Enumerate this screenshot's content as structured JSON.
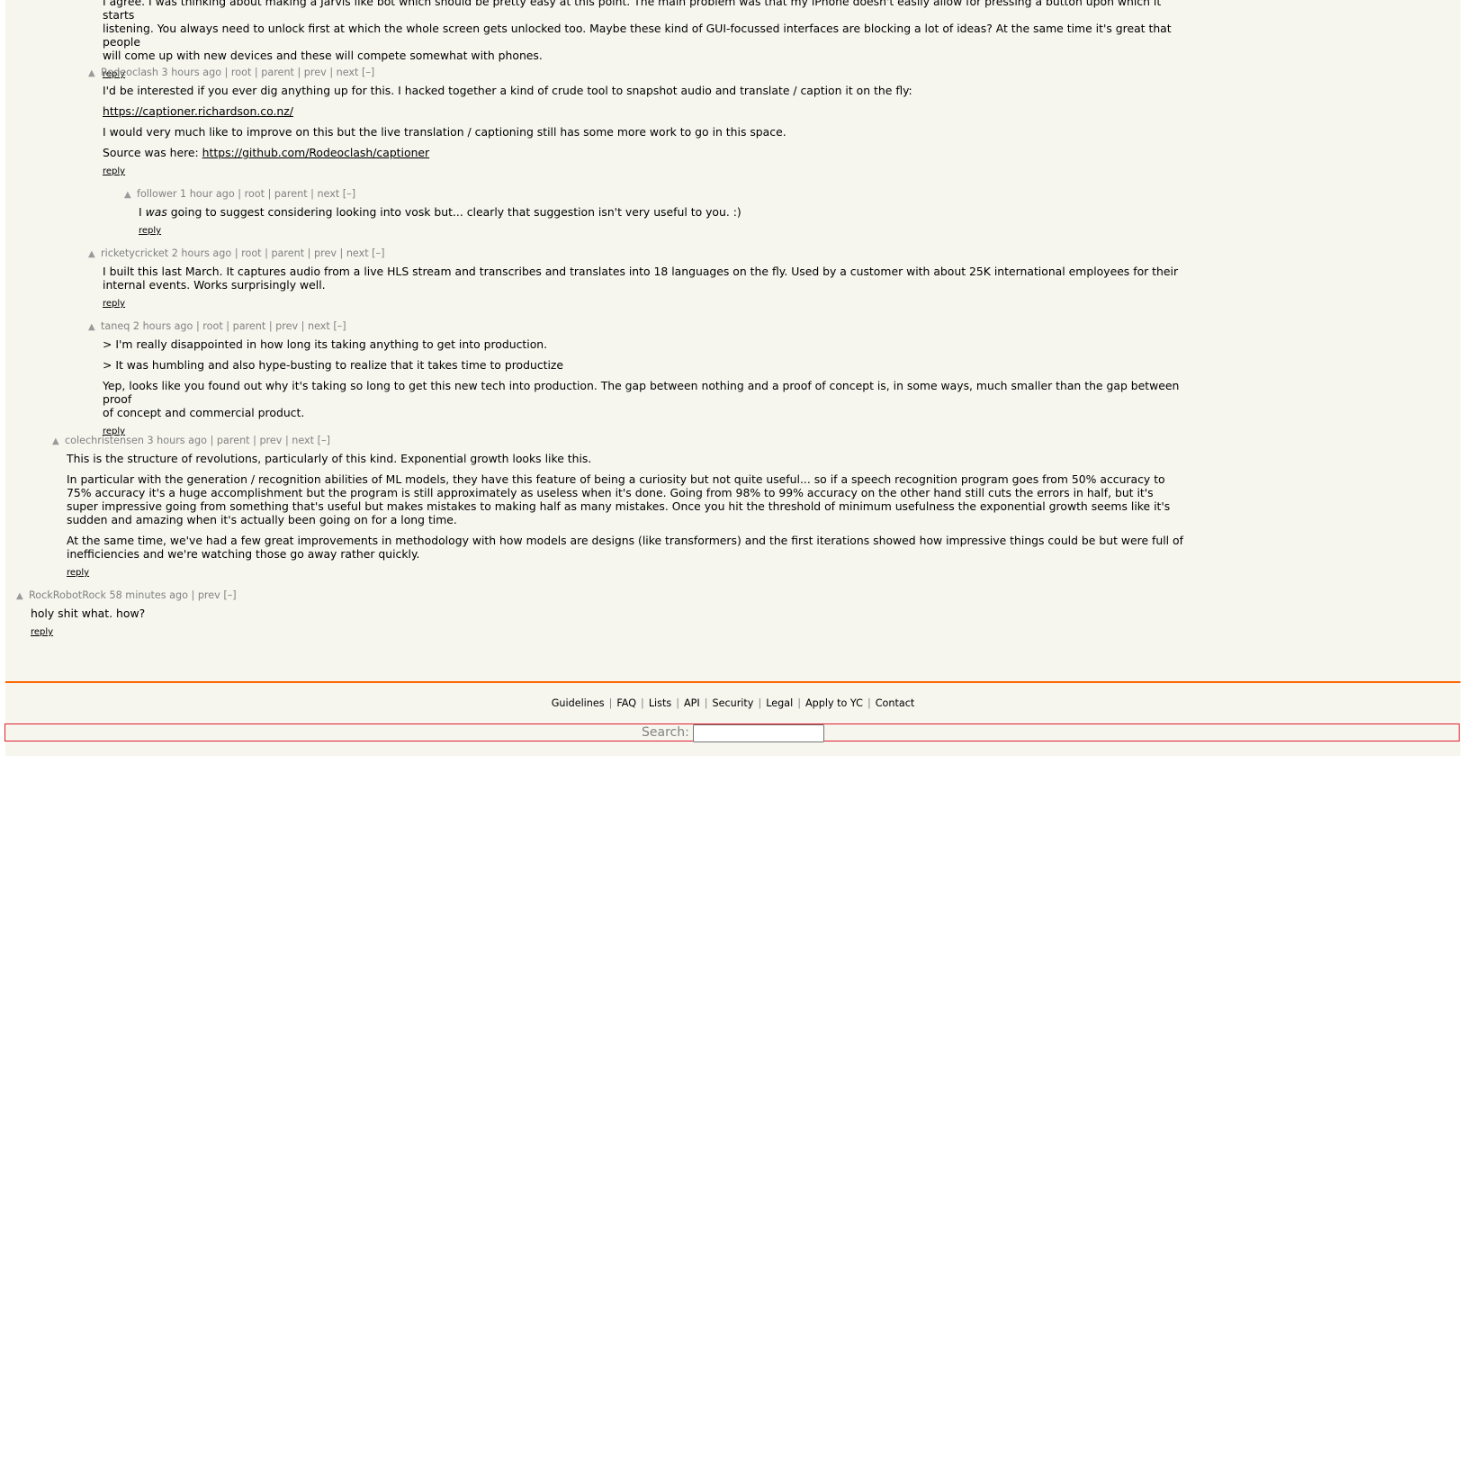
{
  "vote_arrow": "▲",
  "reply_label": "reply",
  "accent_color": "#ff6600",
  "comments": [
    {
      "lines": [
        "I agree. I was thinking about making a Jarvis like bot which should be pretty easy at this point. The main problem was that my iPhone doesn't easily allow for pressing a button upon which it starts",
        "listening. You always need to unlock first at which the whole screen gets unlocked too. Maybe these kind of GUI-focussed interfaces are blocking a lot of ideas? At the same time it's great that people",
        "will come up with new devices and these will compete somewhat with phones."
      ]
    },
    {
      "user": "Rodeoclash",
      "age": "3 hours ago",
      "links": "| root | parent | prev | next [–]",
      "p1": "I'd be interested if you ever dig anything up for this. I hacked together a kind of crude tool to snapshot audio and translate / caption it on the fly:",
      "link1": "https://captioner.richardson.co.nz/",
      "p3": "I would very much like to improve on this but the live translation / captioning still has some more work to go in this space.",
      "p4_prefix": "Source was here: ",
      "link2": "https://github.com/Rodeoclash/captioner"
    },
    {
      "user": "follower",
      "age": "1 hour ago",
      "links": "| root | parent | next [–]",
      "before": "I ",
      "em": "was",
      "after": " going to suggest considering looking into vosk but... clearly that suggestion isn't very useful to you. :)"
    },
    {
      "user": "ricketycricket",
      "age": "2 hours ago",
      "links": "| root | parent | prev | next [–]",
      "lines": [
        "I built this last March. It captures audio from a live HLS stream and transcribes and translates into 18 languages on the fly. Used by a customer with about 25K international employees for their",
        "internal events. Works surprisingly well."
      ]
    },
    {
      "user": "taneq",
      "age": "2 hours ago",
      "links": "| root | parent | prev | next [–]",
      "p1": "> I'm really disappointed in how long its taking anything to get into production.",
      "p2": "> It was humbling and also hype-busting to realize that it takes time to productize",
      "p3_lines": [
        "Yep, looks like you found out why it's taking so long to get this new tech into production. The gap between nothing and a proof of concept is, in some ways, much smaller than the gap between proof",
        "of concept and commercial product."
      ]
    },
    {
      "user": "colechristensen",
      "age": "3 hours ago",
      "links": "| parent | prev | next [–]",
      "p1": "This is the structure of revolutions, particularly of this kind. Exponential growth looks like this.",
      "p2_lines": [
        "In particular with the generation / recognition abilities of ML models, they have this feature of being a curiosity but not quite useful... so if a speech recognition program goes from 50% accuracy to",
        "75% accuracy it's a huge accomplishment but the program is still approximately as useless when it's done. Going from 98% to 99% accuracy on the other hand still cuts the errors in half, but it's",
        "super impressive going from something that's useful but makes mistakes to making half as many mistakes. Once you hit the threshold of minimum usefulness the exponential growth seems like it's",
        "sudden and amazing when it's actually been going on for a long time."
      ],
      "p3_lines": [
        "At the same time, we've had a few great improvements in methodology with how models are designs (like transformers) and the first iterations showed how impressive things could be but were full of",
        "inefficiencies and we're watching those go away rather quickly."
      ]
    },
    {
      "user": "RockRobotRock",
      "age": "58 minutes ago",
      "links": "| prev [–]",
      "text": "holy shit what. how?"
    }
  ],
  "footer": {
    "links": [
      "Guidelines",
      "FAQ",
      "Lists",
      "API",
      "Security",
      "Legal",
      "Apply to YC",
      "Contact"
    ],
    "separator": "|",
    "search_label": "Search:",
    "search_value": ""
  }
}
